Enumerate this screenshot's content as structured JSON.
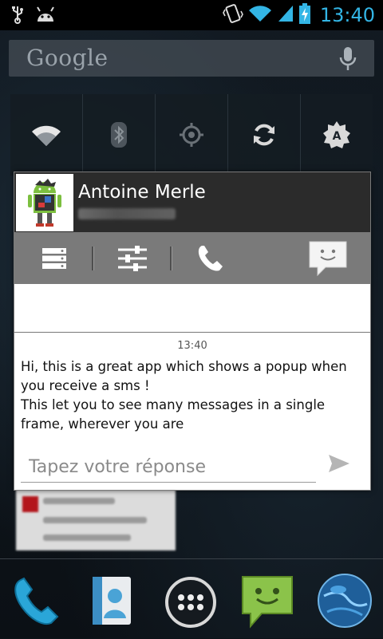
{
  "status_bar": {
    "time": "13:40",
    "icons": [
      "usb-icon",
      "android-debug-icon",
      "vibrate-icon",
      "wifi-icon",
      "signal-icon",
      "battery-charging-icon"
    ],
    "accent_color": "#33b5e5"
  },
  "search_bar": {
    "logo_text": "Google",
    "icon": "mic-icon"
  },
  "quick_settings": {
    "tiles": [
      "wifi-icon",
      "bluetooth-icon",
      "gps-icon",
      "sync-icon",
      "auto-brightness-icon"
    ]
  },
  "dock": {
    "items": [
      "phone-icon",
      "contacts-icon",
      "app-drawer-icon",
      "messaging-icon",
      "browser-icon"
    ]
  },
  "popup": {
    "contact_name": "Antoine Merle",
    "toolbar": [
      "inbox-icon",
      "settings-sliders-icon",
      "call-icon",
      "quick-reply-smiley-icon"
    ],
    "timestamp": "13:40",
    "message": "Hi, this is a great app which shows a popup when you receive a sms !\nThis let you to see many messages in a single frame, wherever you are",
    "reply_placeholder": "Tapez votre réponse",
    "header_bg": "#2b2b2b",
    "toolbar_bg": "#7a7a7a"
  }
}
